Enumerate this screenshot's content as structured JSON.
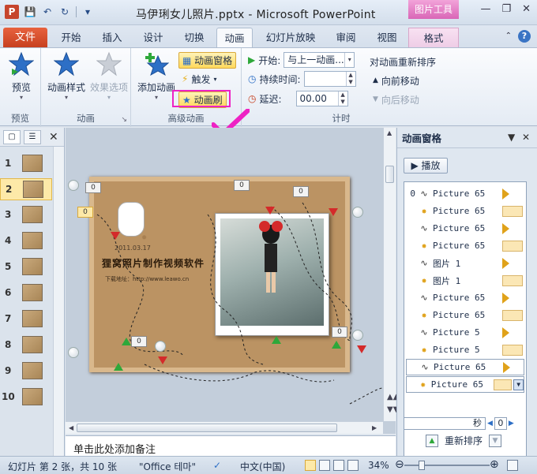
{
  "window": {
    "title": "马伊琍女儿照片.pptx  -  Microsoft PowerPoint",
    "context_tab_group": "图片工具",
    "app_icon_letter": "P"
  },
  "tabs": {
    "file": "文件",
    "items": [
      "开始",
      "插入",
      "设计",
      "切换",
      "动画",
      "幻灯片放映",
      "审阅",
      "视图",
      "格式"
    ],
    "active": "动画"
  },
  "ribbon": {
    "preview": {
      "label": "预览",
      "group": "预览"
    },
    "animation": {
      "style_label": "动画样式",
      "effect_label": "效果选项",
      "group": "动画"
    },
    "advanced": {
      "add_label": "添加动画",
      "pane_label": "动画窗格",
      "trigger_label": "触发",
      "painter_label": "动画刷",
      "group": "高级动画"
    },
    "timing": {
      "start_label": "开始:",
      "start_value": "与上一动画...",
      "duration_label": "持续时间:",
      "duration_value": "",
      "delay_label": "延迟:",
      "delay_value": "00.00",
      "reorder_title": "对动画重新排序",
      "forward_label": "向前移动",
      "backward_label": "向后移动",
      "group": "计时"
    }
  },
  "thumbnails": {
    "numbers": [
      "1",
      "2",
      "3",
      "4",
      "5",
      "6",
      "7",
      "8",
      "9",
      "10"
    ],
    "selected": "2"
  },
  "slide": {
    "title": "狸窝照片制作视频软件",
    "date": "2011.03.17",
    "site": "下载地址：http://www.leawo.cn",
    "tags": [
      "0",
      "0",
      "0",
      "0",
      "0",
      "0"
    ],
    "left_tag": "0"
  },
  "notes": {
    "placeholder": "单击此处添加备注"
  },
  "anim_pane": {
    "title": "动画窗格",
    "play_label": "播放",
    "items": [
      {
        "num": "0",
        "kind": "path",
        "label": "Picture 65",
        "bar": "tri"
      },
      {
        "num": "",
        "kind": "burst",
        "label": "Picture 65",
        "bar": "bar"
      },
      {
        "num": "",
        "kind": "path",
        "label": "Picture 65",
        "bar": "tri"
      },
      {
        "num": "",
        "kind": "burst",
        "label": "Picture 65",
        "bar": "bar"
      },
      {
        "num": "",
        "kind": "path",
        "label": "图片 1",
        "bar": "tri"
      },
      {
        "num": "",
        "kind": "burst",
        "label": "图片 1",
        "bar": "bar"
      },
      {
        "num": "",
        "kind": "path",
        "label": "Picture 65",
        "bar": "tri"
      },
      {
        "num": "",
        "kind": "burst",
        "label": "Picture 65",
        "bar": "bar"
      },
      {
        "num": "",
        "kind": "path",
        "label": "Picture 5",
        "bar": "tri"
      },
      {
        "num": "",
        "kind": "burst",
        "label": "Picture 5",
        "bar": "bar"
      },
      {
        "num": "",
        "kind": "path",
        "label": "Picture 65",
        "bar": "tri"
      },
      {
        "num": "",
        "kind": "burst",
        "label": "Picture 65",
        "bar": "bar"
      }
    ],
    "timing_unit": "秒",
    "timing_zoom": "0",
    "reorder_label": "重新排序"
  },
  "status": {
    "slide_info": "幻灯片 第 2 张，共 10 张",
    "theme": "\"Office 테마\"",
    "language": "中文(中国)",
    "zoom": "34%"
  },
  "colors": {
    "accent_pink": "#ee22c4",
    "file_tab": "#d4502a",
    "context_tab": "#e07ac6"
  }
}
